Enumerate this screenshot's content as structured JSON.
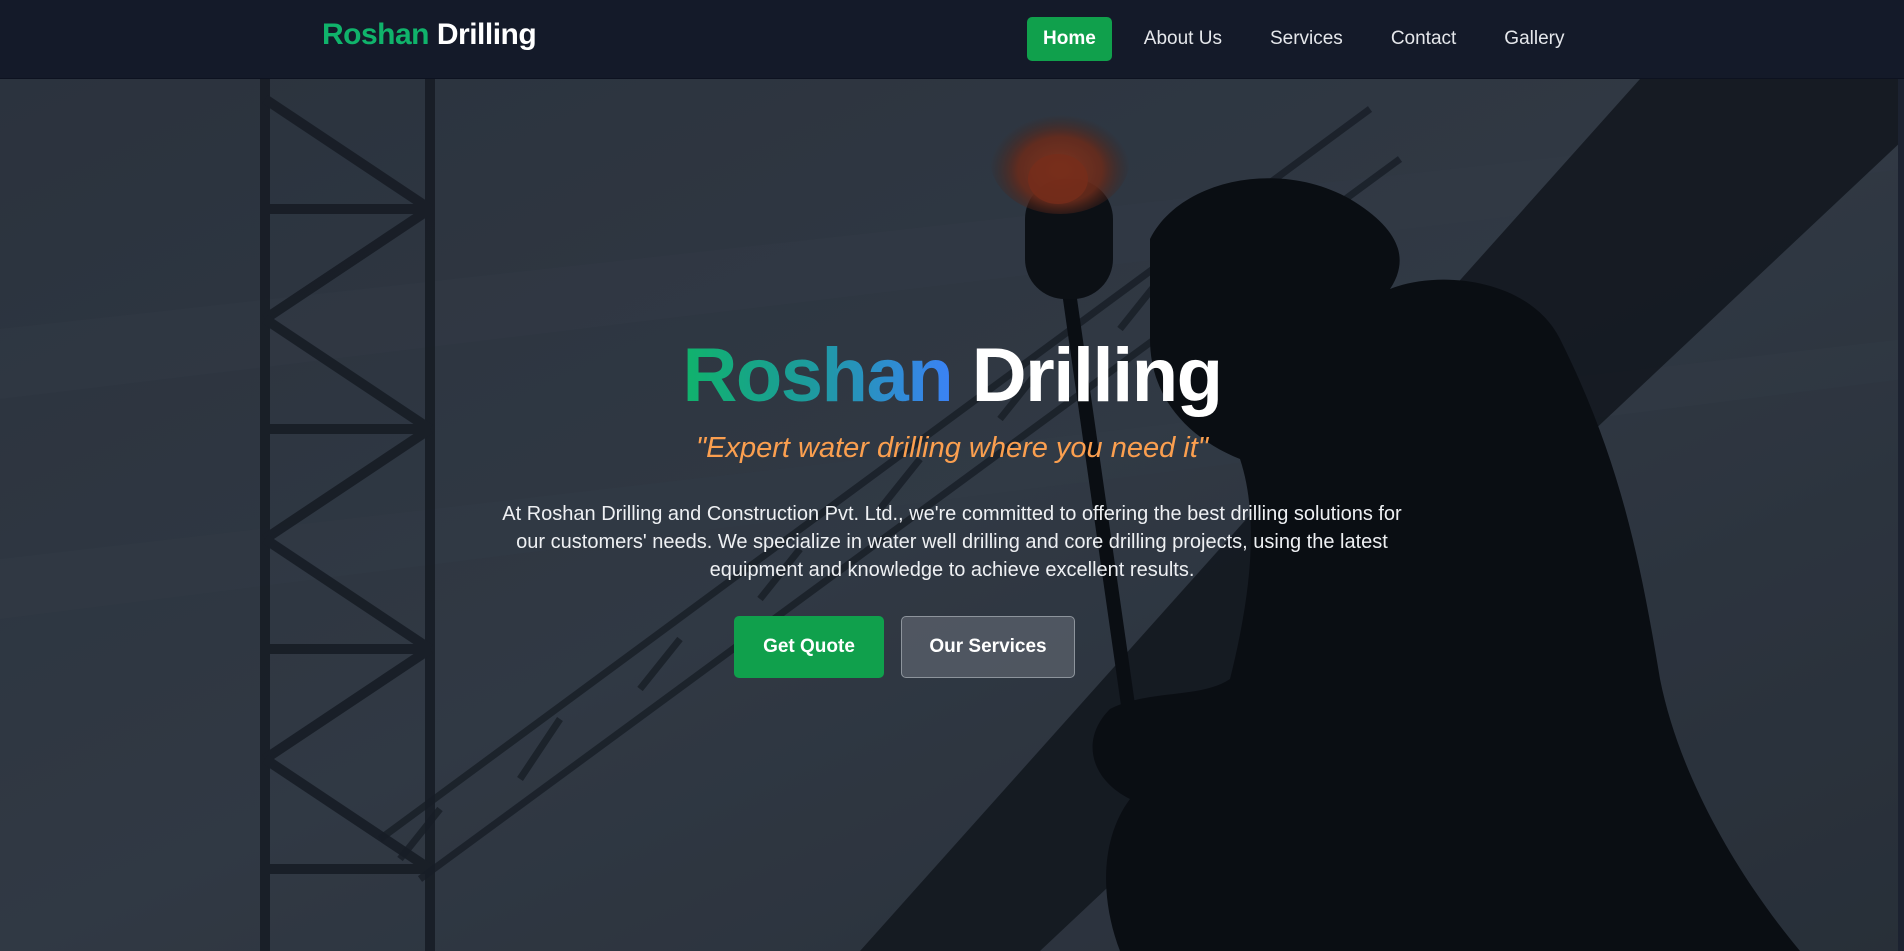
{
  "brand": {
    "part1": "Roshan",
    "part2": "Drilling",
    "accent_color": "#10b36b"
  },
  "nav": {
    "items": [
      {
        "label": "Home",
        "active": true
      },
      {
        "label": "About Us",
        "active": false
      },
      {
        "label": "Services",
        "active": false
      },
      {
        "label": "Contact",
        "active": false
      },
      {
        "label": "Gallery",
        "active": false
      }
    ]
  },
  "hero": {
    "title_part1": "Roshan",
    "title_part2": "Drilling",
    "tagline": "\"Expert water drilling where you need it\"",
    "description": "At Roshan Drilling and Construction Pvt. Ltd., we're committed to offering the best drilling solutions for our customers' needs. We specialize in water well drilling and core drilling projects, using the latest equipment and knowledge to achieve excellent results.",
    "primary_button": "Get Quote",
    "secondary_button": "Our Services",
    "tagline_color": "#fb9f4f",
    "button_color": "#10a04c"
  }
}
